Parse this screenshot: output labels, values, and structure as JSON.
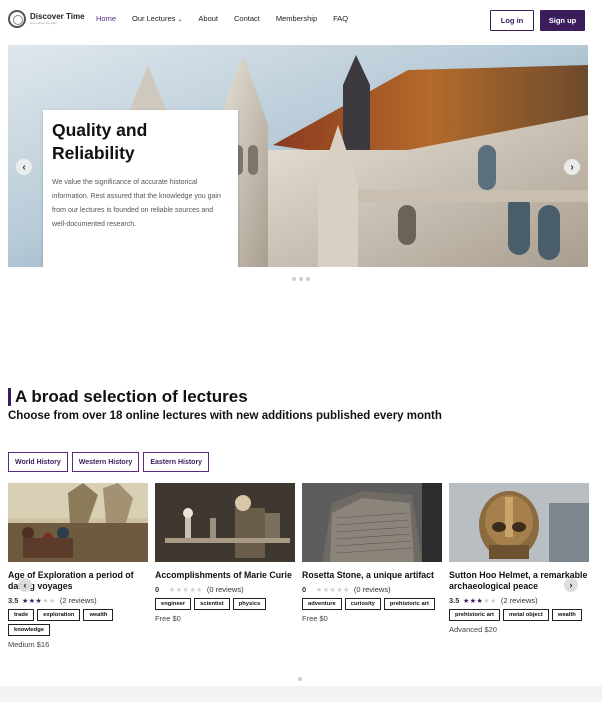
{
  "header": {
    "logo_title": "Discover Time",
    "logo_sub": "learn about the past",
    "nav": [
      {
        "label": "Home",
        "active": true
      },
      {
        "label": "Our Lectures",
        "active": false,
        "has_dropdown": true
      },
      {
        "label": "About",
        "active": false
      },
      {
        "label": "Contact",
        "active": false
      },
      {
        "label": "Membership",
        "active": false
      },
      {
        "label": "FAQ",
        "active": false
      }
    ],
    "login_label": "Log in",
    "signup_label": "Sign up"
  },
  "hero": {
    "title": "Quality and Reliability",
    "body": "We value the significance of accurate historical information. Rest assured that the knowledge you gain from our lectures is founded on reliable sources and well-documented research.",
    "prev_icon": "chevron-left-icon",
    "next_icon": "chevron-right-icon",
    "slide_count": 3
  },
  "section": {
    "title": "A broad selection of lectures",
    "subtitle": "Choose from over 18 online lectures with new additions published every month"
  },
  "filters": [
    "World History",
    "Western History",
    "Eastern History"
  ],
  "lectures": [
    {
      "title": "Age of Exploration a period of daring voyages",
      "rating": "3.5",
      "stars": 3,
      "reviews": "(2 reviews)",
      "tags": [
        "trade",
        "exploration",
        "wealth",
        "knowledge"
      ],
      "price": "Medium $16"
    },
    {
      "title": "Accomplishments of Marie Curie",
      "rating": "0",
      "stars": 0,
      "reviews": "(0 reviews)",
      "tags": [
        "engineer",
        "scientist",
        "physics"
      ],
      "price": "Free $0"
    },
    {
      "title": "Rosetta Stone, a unique artifact",
      "rating": "0",
      "stars": 0,
      "reviews": "(0 reviews)",
      "tags": [
        "adventure",
        "curiosity",
        "prehistoric art"
      ],
      "price": "Free $0"
    },
    {
      "title": "Sutton Hoo Helmet, a remarkable archaeological peace",
      "rating": "3.5",
      "stars": 3,
      "reviews": "(2 reviews)",
      "tags": [
        "prehistoric art",
        "metal object",
        "wealth"
      ],
      "price": "Advanced $20"
    }
  ],
  "colors": {
    "brand": "#3b1d5c",
    "accent": "#5a2a82"
  }
}
